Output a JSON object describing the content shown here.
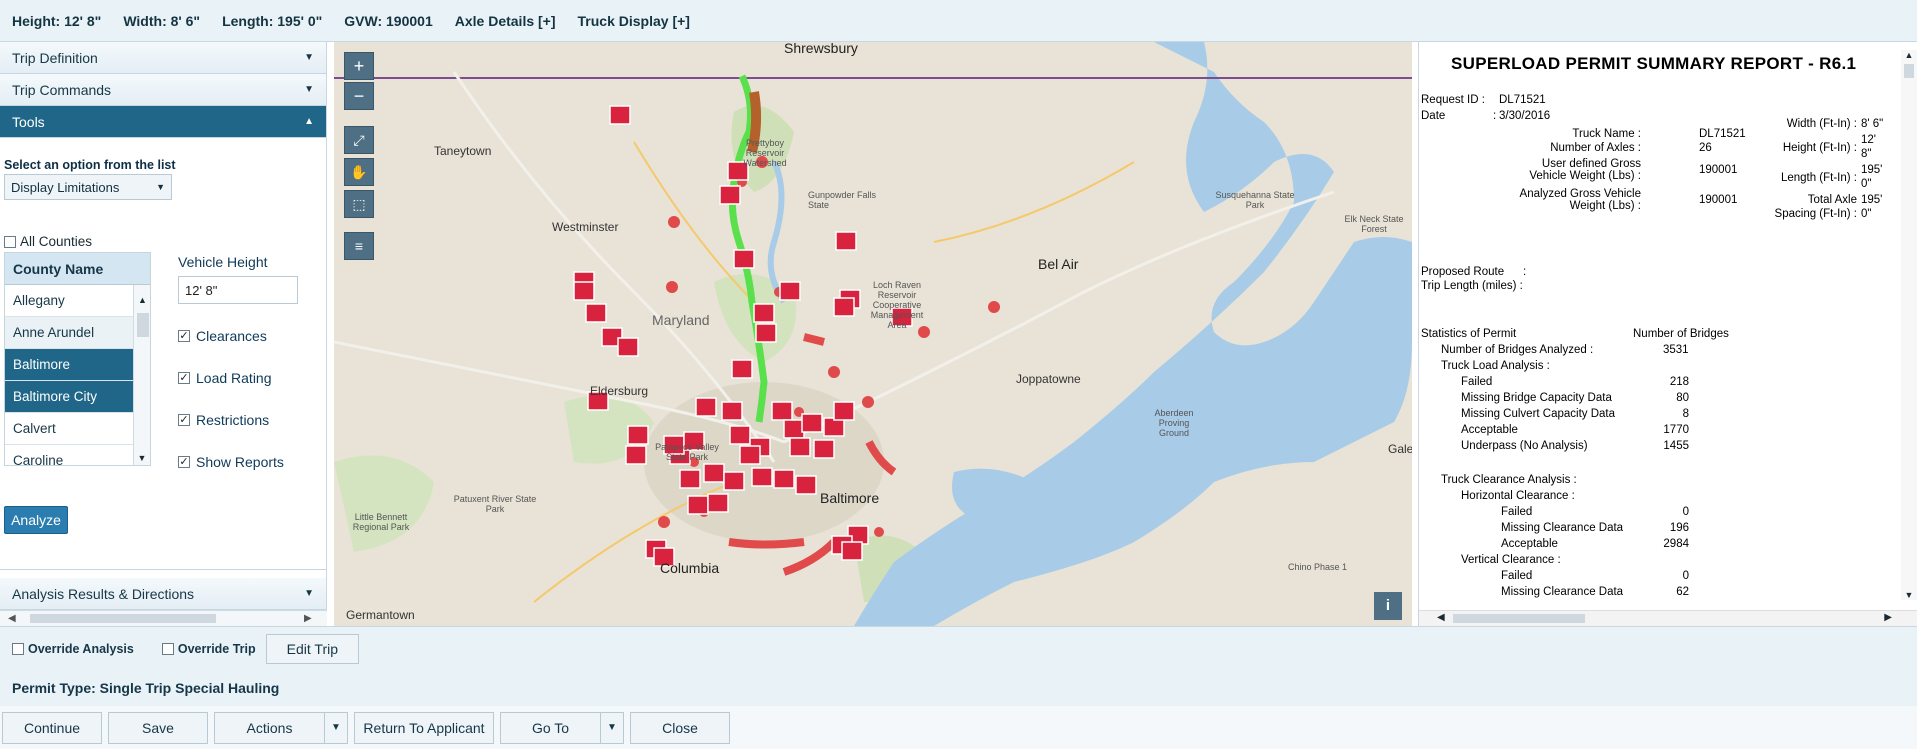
{
  "topbar": {
    "height": "Height: 12' 8\"",
    "width": "Width: 8' 6\"",
    "length": "Length: 195' 0\"",
    "gvw": "GVW: 190001",
    "axle": "Axle Details [+]",
    "truck": "Truck Display [+]"
  },
  "sidebar": {
    "trip_definition": "Trip Definition",
    "trip_commands": "Trip Commands",
    "tools": "Tools",
    "select_label": "Select an option from the list",
    "select_value": "Display Limitations",
    "all_counties": "All Counties",
    "county_header": "County Name",
    "counties": [
      "Allegany",
      "Anne Arundel",
      "Baltimore",
      "Baltimore City",
      "Calvert",
      "Caroline"
    ],
    "vehicle_height_label": "Vehicle Height",
    "vehicle_height_value": "12' 8\"",
    "options": [
      "Clearances",
      "Load Rating",
      "Restrictions",
      "Show Reports"
    ],
    "analyze": "Analyze",
    "analysis_results": "Analysis Results & Directions"
  },
  "map": {
    "labels": [
      "Shrewsbury",
      "Prettyboy Reservoir Watershed",
      "Gunpowder Falls State",
      "Taneytown",
      "Westminster",
      "Loch Raven Reservoir Cooperative Management Area",
      "Bel Air",
      "Susquehanna State Park",
      "Elk Neck State Forest",
      "Maryland",
      "Eldersburg",
      "Joppatowne",
      "Aberdeen Proving Ground",
      "Patapsco Valley State Park",
      "Patuxent River State Park",
      "Little Bennett Regional Park",
      "Columbia",
      "Baltimore",
      "Galena",
      "Chino Phase 1",
      "Germantown"
    ],
    "info": "i"
  },
  "report": {
    "title": "SUPERLOAD PERMIT SUMMARY REPORT - R6.1",
    "request_id_label": "Request ID :",
    "request_id": "DL71521",
    "date_label": "Date",
    "date": "3/30/2016",
    "truck_name_label": "Truck Name :",
    "truck_name": "DL71521",
    "axles_label": "Number of Axles :",
    "axles": "26",
    "udgvw_label1": "User defined Gross",
    "udgvw_label2": "Vehicle Weight (Lbs) :",
    "udgvw": "190001",
    "agvw_label1": "Analyzed Gross Vehicle",
    "agvw_label2": "Weight (Lbs) :",
    "agvw": "190001",
    "width_label": "Width (Ft-In) :",
    "width": "8' 6\"",
    "height_label": "Height (Ft-In) :",
    "height1": "12'",
    "height2": "8\"",
    "length_label": "Length (Ft-In) :",
    "length1": "195'",
    "length2": "0\"",
    "axle_spacing_label1": "Total Axle",
    "axle_spacing_label2": "Spacing (Ft-In) :",
    "axle_spacing1": "195'",
    "axle_spacing2": "0\"",
    "proposed_route": "Proposed Route",
    "trip_length": "Trip Length (miles) :",
    "stats_label": "Statistics of Permit",
    "bridges_label": "Number of Bridges",
    "analyzed_label": "Number of Bridges Analyzed :",
    "analyzed": "3531",
    "truck_load": "Truck Load Analysis :",
    "failed_label": "Failed",
    "failed": "218",
    "missing_bridge_label": "Missing Bridge Capacity Data",
    "missing_bridge": "80",
    "missing_culvert_label": "Missing Culvert Capacity Data",
    "missing_culvert": "8",
    "acceptable_label": "Acceptable",
    "acceptable": "1770",
    "underpass_label": "Underpass (No Analysis)",
    "underpass": "1455",
    "clearance_label": "Truck Clearance Analysis :",
    "horizontal_label": "Horizontal Clearance :",
    "h_failed": "0",
    "h_missing_label": "Missing Clearance Data",
    "h_missing": "196",
    "h_acceptable": "2984",
    "vertical_label": "Vertical Clearance :",
    "v_failed": "0",
    "v_missing": "62"
  },
  "bottom": {
    "override_analysis": "Override Analysis",
    "override_trip": "Override Trip",
    "edit_trip": "Edit Trip",
    "permit_type": "Permit Type: Single Trip Special Hauling",
    "buttons": [
      "Continue",
      "Save",
      "Actions",
      "Return To Applicant",
      "Go To",
      "Close"
    ]
  }
}
